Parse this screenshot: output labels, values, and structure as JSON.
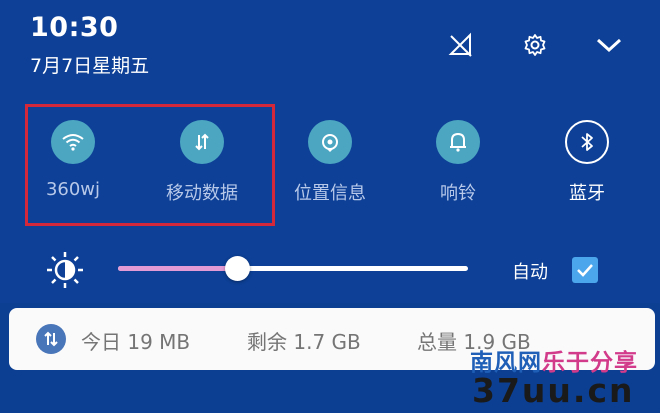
{
  "status": {
    "time": "10:30",
    "date": "7月7日星期五"
  },
  "header_icons": [
    "no-sim-icon",
    "gear-icon",
    "chevron-down-icon"
  ],
  "tiles": [
    {
      "label": "360wj",
      "icon": "wifi-icon",
      "state": "on"
    },
    {
      "label": "移动数据",
      "icon": "mobile-data-icon",
      "state": "on"
    },
    {
      "label": "位置信息",
      "icon": "location-icon",
      "state": "on"
    },
    {
      "label": "响铃",
      "icon": "bell-icon",
      "state": "on"
    },
    {
      "label": "蓝牙",
      "icon": "bluetooth-icon",
      "state": "off"
    }
  ],
  "brightness": {
    "level": 0.34,
    "auto_label": "自动",
    "auto_checked": true
  },
  "data_usage": {
    "today": "今日 19 MB",
    "remaining": "剩余 1.7 GB",
    "total": "总量 1.9 GB"
  },
  "watermark": {
    "line1_part1": "南风网",
    "line1_part2": "乐于分享",
    "line2": "37uu.cn"
  },
  "colors": {
    "panel_bg": "#0d4096",
    "tile_on": "#4ca6c2",
    "highlight_border": "#d3283a",
    "slider_fill": "#e39bd5",
    "checkbox": "#4ca6ec"
  }
}
